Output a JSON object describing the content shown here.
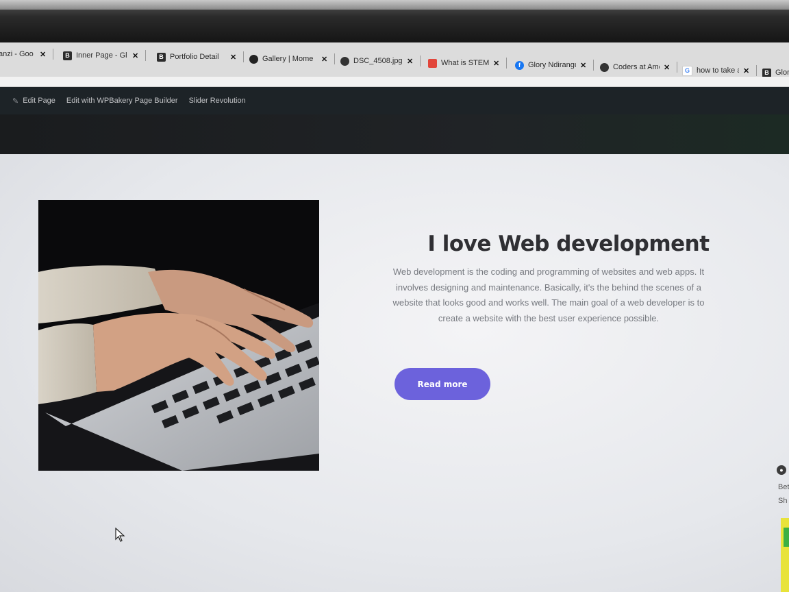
{
  "browser": {
    "tabs": [
      {
        "title": "anzi - Goo",
        "favicon": "google-icon",
        "color": "#1a73e8",
        "glyph": ""
      },
      {
        "title": "Inner Page - Gl",
        "favicon": "bootstrap-icon",
        "color": "#2c2c2c",
        "glyph": "B"
      },
      {
        "title": "Portfolio Detail",
        "favicon": "bootstrap-icon",
        "color": "#2c2c2c",
        "glyph": "B"
      },
      {
        "title": "Gallery | Mome",
        "favicon": "gallery-icon",
        "color": "#222222",
        "glyph": ""
      },
      {
        "title": "DSC_4508.jpg",
        "favicon": "globe-icon",
        "color": "#333333",
        "glyph": ""
      },
      {
        "title": "What is STEM",
        "favicon": "site-icon",
        "color": "#e2463b",
        "glyph": ""
      },
      {
        "title": "Glory Ndirangu",
        "favicon": "facebook-icon",
        "color": "#1877f2",
        "glyph": "f"
      },
      {
        "title": "Coders at Ame",
        "favicon": "globe-icon",
        "color": "#333333",
        "glyph": ""
      },
      {
        "title": "how to take a s",
        "favicon": "google-icon",
        "color": "#ffffff",
        "glyph": "G"
      },
      {
        "title": "Glory",
        "favicon": "bootstrap-icon",
        "color": "#2c2c2c",
        "glyph": "B"
      }
    ],
    "close_glyph": "✕"
  },
  "admin_bar": {
    "edit_page": "Edit Page",
    "edit_wpbakery": "Edit with WPBakery Page Builder",
    "slider_revolution": "Slider Revolution"
  },
  "content": {
    "heading": "I love Web development",
    "description": "Web development is the  coding and programming of websites and web  apps. It involves designing and maintenance. Basically, it's the behind the scenes of a website that looks good and works well. The main goal of a web developer is to create a website with the best user experience possible.",
    "read_more": "Read more",
    "button_color": "#6c62dc"
  },
  "side_panel": {
    "line1": "Bet",
    "line2": "Sh"
  }
}
